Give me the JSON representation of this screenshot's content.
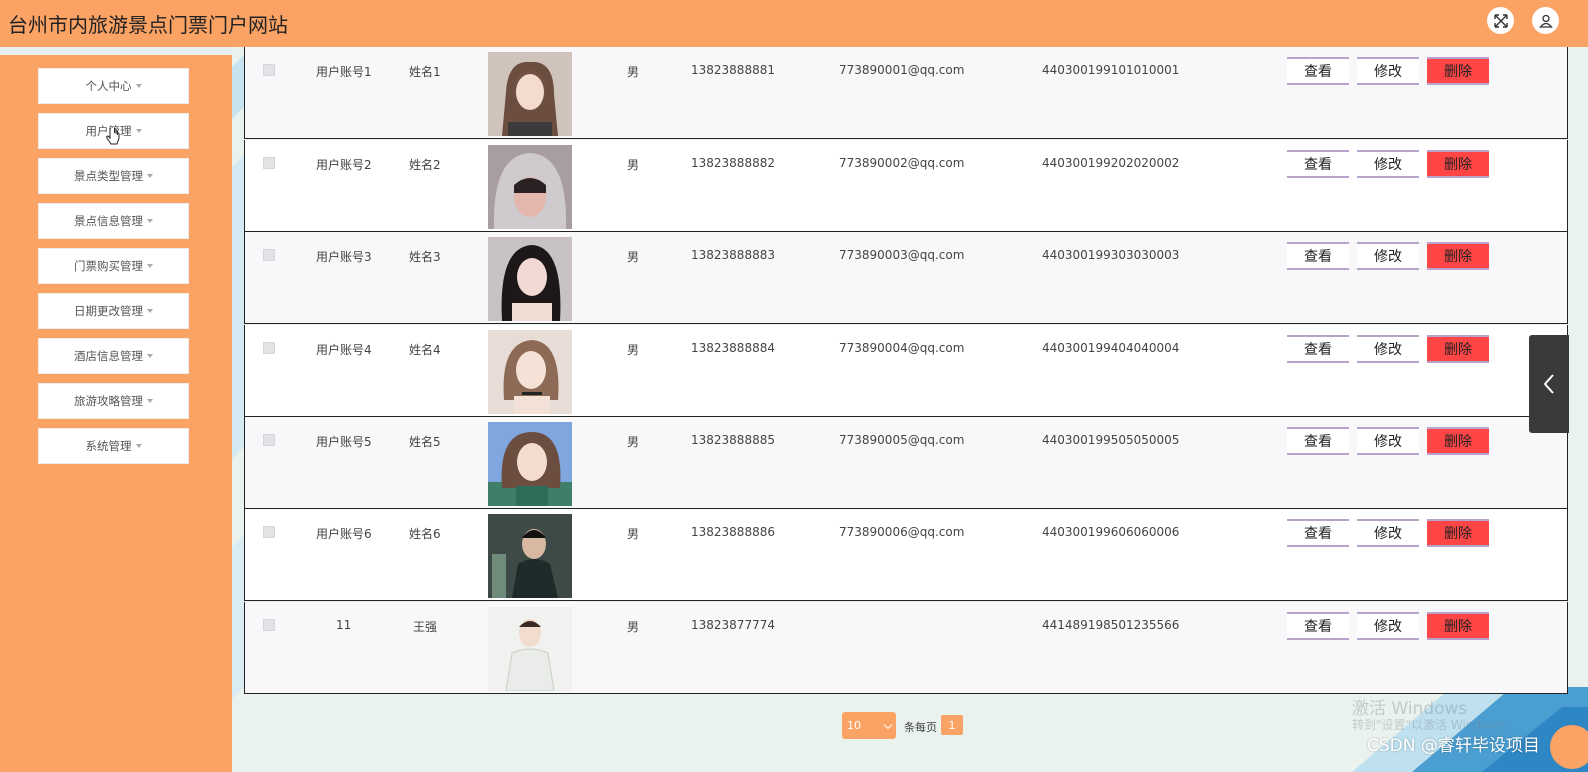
{
  "header": {
    "title": "台州市内旅游景点门票门户网站",
    "fullscreen_icon": "expand-icon",
    "user_icon": "user-icon"
  },
  "sidebar": {
    "items": [
      {
        "label": "个人中心"
      },
      {
        "label": "用户管理"
      },
      {
        "label": "景点类型管理"
      },
      {
        "label": "景点信息管理"
      },
      {
        "label": "门票购买管理"
      },
      {
        "label": "日期更改管理"
      },
      {
        "label": "酒店信息管理"
      },
      {
        "label": "旅游攻略管理"
      },
      {
        "label": "系统管理"
      }
    ]
  },
  "table": {
    "actions": {
      "view": "查看",
      "edit": "修改",
      "delete": "删除"
    },
    "rows": [
      {
        "account": "用户账号1",
        "name": "姓名1",
        "gender": "男",
        "phone": "13823888881",
        "email": "773890001@qq.com",
        "id_card": "440300199101010001"
      },
      {
        "account": "用户账号2",
        "name": "姓名2",
        "gender": "男",
        "phone": "13823888882",
        "email": "773890002@qq.com",
        "id_card": "440300199202020002"
      },
      {
        "account": "用户账号3",
        "name": "姓名3",
        "gender": "男",
        "phone": "13823888883",
        "email": "773890003@qq.com",
        "id_card": "440300199303030003"
      },
      {
        "account": "用户账号4",
        "name": "姓名4",
        "gender": "男",
        "phone": "13823888884",
        "email": "773890004@qq.com",
        "id_card": "440300199404040004"
      },
      {
        "account": "用户账号5",
        "name": "姓名5",
        "gender": "男",
        "phone": "13823888885",
        "email": "773890005@qq.com",
        "id_card": "440300199505050005"
      },
      {
        "account": "用户账号6",
        "name": "姓名6",
        "gender": "男",
        "phone": "13823888886",
        "email": "773890006@qq.com",
        "id_card": "440300199606060006"
      },
      {
        "account": "11",
        "name": "王强",
        "gender": "男",
        "phone": "13823877774",
        "email": "",
        "id_card": "441489198501235566"
      }
    ]
  },
  "pagination": {
    "page_size": "10",
    "per_page_label": "条每页",
    "current_page": "1"
  },
  "overlay": {
    "win_line1": "激活 Windows",
    "win_line2": "转到\"设置\"以激活 Windows。",
    "csdn": "CSDN @睿轩毕设项目"
  },
  "colors": {
    "accent": "#fba364",
    "delete": "#ff4545",
    "action_border": "#b9a3cc"
  }
}
